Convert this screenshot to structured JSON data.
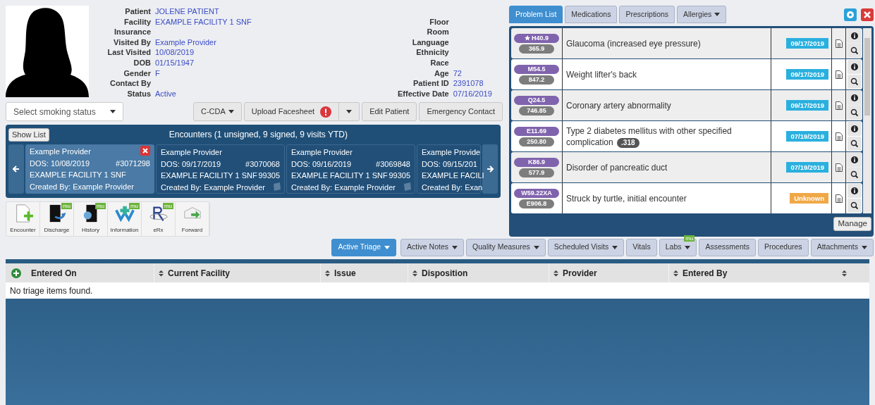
{
  "patient": {
    "left_fields": [
      {
        "label": "Patient",
        "value": "JOLENE PATIENT"
      },
      {
        "label": "Facility",
        "value": "EXAMPLE FACILITY 1 SNF"
      },
      {
        "label": "Insurance"
      },
      {
        "label": "Visited By",
        "value": "Example Provider"
      },
      {
        "label": "Last Visited",
        "value": "10/08/2019"
      },
      {
        "label": "DOB",
        "value": "01/15/1947"
      },
      {
        "label": "Gender",
        "value": "F"
      },
      {
        "label": "Contact By"
      },
      {
        "label": "Status",
        "value": "Active"
      }
    ],
    "right_fields": [
      {
        "label": "Floor"
      },
      {
        "label": "Room"
      },
      {
        "label": "Language"
      },
      {
        "label": "Ethnicity"
      },
      {
        "label": "Race"
      },
      {
        "label": "Age",
        "value": "72"
      },
      {
        "label": "Patient ID",
        "value": "2391078"
      },
      {
        "label": "Effective Date",
        "value": "07/16/2019"
      }
    ]
  },
  "smoking_select": {
    "placeholder": "Select smoking status"
  },
  "actions": [
    {
      "label": "C-CDA",
      "kind": "dropdown"
    },
    {
      "label": "Upload Facesheet",
      "kind": "split-alert"
    },
    {
      "label": "Edit Patient",
      "kind": "button"
    },
    {
      "label": "Emergency Contact",
      "kind": "button"
    }
  ],
  "encounters": {
    "show_list": "Show List",
    "title": "Encounters (1 unsigned, 9 signed, 9 visits YTD)",
    "cards": [
      {
        "provider": "Example Provider",
        "dos": "DOS: 10/08/2019",
        "number": "#3071298",
        "facility": "EXAMPLE FACILITY 1 SNF",
        "created_by": "Created By: Example Provider",
        "signed": false
      },
      {
        "provider": "Example Provider",
        "dos": "DOS: 09/17/2019",
        "number": "#3070068",
        "facility": "EXAMPLE FACILITY 1 SNF",
        "code": "99305",
        "created_by": "Created By: Example Provider",
        "signed": true
      },
      {
        "provider": "Example Provider",
        "dos": "DOS: 09/16/2019",
        "number": "#3069848",
        "facility": "EXAMPLE FACILITY 1 SNF",
        "code": "99305",
        "created_by": "Created By: Example Provider",
        "signed": true
      },
      {
        "provider": "Example Provide",
        "dos": "DOS: 09/15/201",
        "facility": "EXAMPLE FACILI",
        "created_by": "Created By: Exan",
        "signed": true
      }
    ]
  },
  "toolbar": [
    {
      "label": "Encounter",
      "kind": "encounter"
    },
    {
      "label": "Discharge",
      "kind": "discharge",
      "badge": "mu"
    },
    {
      "label": "History",
      "kind": "history",
      "badge": "mu"
    },
    {
      "label": "Information",
      "kind": "information",
      "badge": "mu"
    },
    {
      "label": "eRx",
      "kind": "erx",
      "badge": "mu"
    },
    {
      "label": "Forward",
      "kind": "forward"
    }
  ],
  "problem_tabs": [
    {
      "label": "Problem List",
      "selected": true,
      "dropdown": false
    },
    {
      "label": "Medications",
      "selected": false,
      "dropdown": false
    },
    {
      "label": "Prescriptions",
      "selected": false,
      "dropdown": false
    },
    {
      "label": "Allergies",
      "selected": false,
      "dropdown": true
    }
  ],
  "problems": [
    {
      "icd10": "H40.9",
      "icd9": "365.9",
      "starred": true,
      "description": "Glaucoma (increased eye pressure)",
      "date": "09/17/2019",
      "date_known": true
    },
    {
      "icd10": "M54.5",
      "icd9": "847.2",
      "starred": false,
      "description": "Weight lifter's back",
      "date": "09/17/2019",
      "date_known": true
    },
    {
      "icd10": "Q24.5",
      "icd9": "746.85",
      "starred": false,
      "description": "Coronary artery abnormality",
      "date": "09/17/2019",
      "date_known": true
    },
    {
      "icd10": "E11.69",
      "icd9": "250.80",
      "starred": false,
      "description": "Type 2 diabetes mellitus with other specified complication",
      "badge": ".318",
      "date": "07/19/2019",
      "date_known": true
    },
    {
      "icd10": "K86.9",
      "icd9": "577.9",
      "starred": false,
      "description": "Disorder of pancreatic duct",
      "date": "07/19/2019",
      "date_known": true
    },
    {
      "icd10": "W59.22XA",
      "icd9": "E906.8",
      "starred": false,
      "description": "Struck by turtle, initial encounter",
      "date": "Unknown",
      "date_known": false
    }
  ],
  "manage": "Manage",
  "bottom_tabs": [
    {
      "label": "Active Triage",
      "selected": true,
      "dropdown": true
    },
    {
      "label": "Active Notes",
      "selected": false,
      "dropdown": true
    },
    {
      "label": "Quality Measures",
      "selected": false,
      "dropdown": true
    },
    {
      "label": "Scheduled Visits",
      "selected": false,
      "dropdown": true
    },
    {
      "label": "Vitals",
      "selected": false,
      "dropdown": false
    },
    {
      "label": "Labs",
      "selected": false,
      "dropdown": true,
      "badge": "mu"
    },
    {
      "label": "Assessments",
      "selected": false,
      "dropdown": false
    },
    {
      "label": "Procedures",
      "selected": false,
      "dropdown": false
    },
    {
      "label": "Attachments",
      "selected": false,
      "dropdown": true
    }
  ],
  "triage": {
    "columns": [
      "Entered On",
      "Current Facility",
      "Issue",
      "Disposition",
      "Provider",
      "Entered By"
    ],
    "empty": "No triage items found."
  }
}
